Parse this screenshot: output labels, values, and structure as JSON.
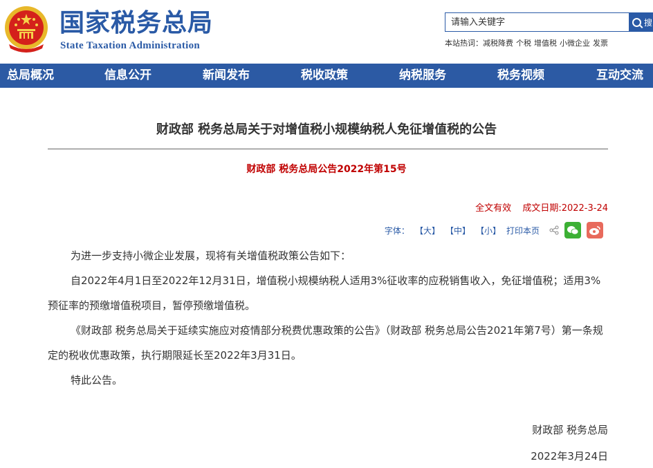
{
  "header": {
    "title": "国家税务总局",
    "subtitle": "State Taxation Administration",
    "search_placeholder": "请输入关键字",
    "search_button": "搜",
    "hot_label": "本站热词：",
    "hot_words": [
      "减税降费",
      "个税",
      "增值税",
      "小微企业",
      "发票"
    ]
  },
  "nav": [
    "总局概况",
    "信息公开",
    "新闻发布",
    "税收政策",
    "纳税服务",
    "税务视频",
    "互动交流"
  ],
  "article": {
    "title": "财政部 税务总局关于对增值税小规模纳税人免征增值税的公告",
    "doc_number": "财政部 税务总局公告2022年第15号",
    "validity": "全文有效",
    "date": "成文日期:2022-3-24",
    "tools": {
      "font_label": "字体：",
      "large": "【大】",
      "medium": "【中】",
      "small": "【小】",
      "print": "打印本页"
    },
    "paragraphs": [
      "为进一步支持小微企业发展，现将有关增值税政策公告如下：",
      "自2022年4月1日至2022年12月31日，增值税小规模纳税人适用3%征收率的应税销售收入，免征增值税；适用3%预征率的预缴增值税项目，暂停预缴增值税。",
      "《财政部 税务总局关于延续实施应对疫情部分税费优惠政策的公告》（财政部 税务总局公告2021年第7号）第一条规定的税收优惠政策，执行期限延长至2022年3月31日。",
      "特此公告。"
    ],
    "signature": "财政部  税务总局",
    "sign_date": "2022年3月24日"
  },
  "colors": {
    "brand_blue": "#2c5aa4",
    "accent_red": "#c00000"
  }
}
